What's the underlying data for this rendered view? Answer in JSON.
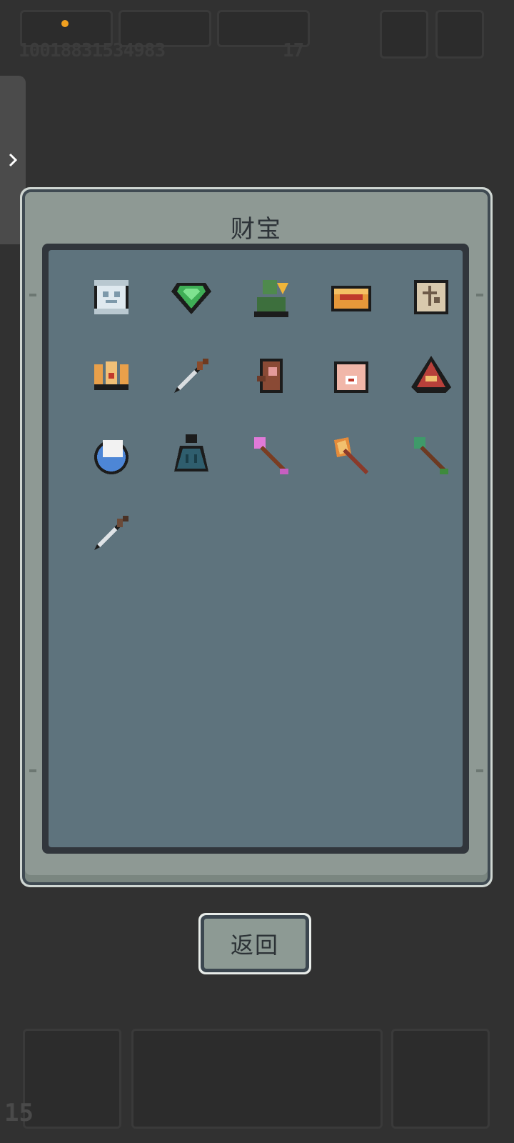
{
  "hud": {
    "stats_text": "10018831534983",
    "stat_right": "17",
    "bottom_count": "15"
  },
  "modal": {
    "title": "财宝",
    "back_label": "返回"
  },
  "treasures": [
    {
      "name": "scroll-icon"
    },
    {
      "name": "green-gem-icon"
    },
    {
      "name": "green-figure-icon"
    },
    {
      "name": "treasure-chest-icon"
    },
    {
      "name": "map-parchment-icon"
    },
    {
      "name": "golden-claws-icon"
    },
    {
      "name": "dagger-icon"
    },
    {
      "name": "brown-idol-icon"
    },
    {
      "name": "eye-hand-icon"
    },
    {
      "name": "red-hood-icon"
    },
    {
      "name": "blue-orb-icon"
    },
    {
      "name": "bell-icon"
    },
    {
      "name": "pink-arrow-icon"
    },
    {
      "name": "axe-icon"
    },
    {
      "name": "green-arrow-icon"
    },
    {
      "name": "short-sword-icon"
    }
  ]
}
